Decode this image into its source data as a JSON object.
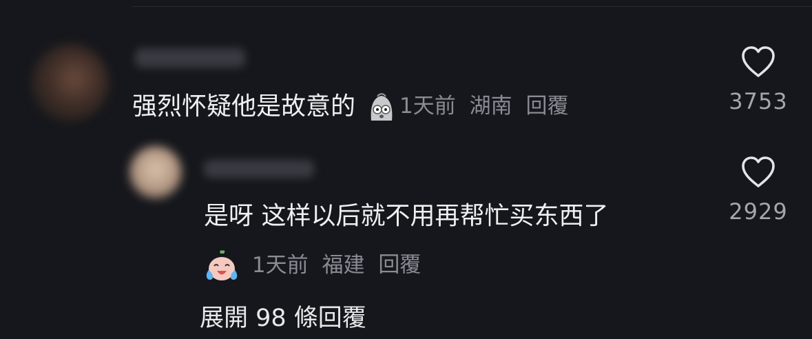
{
  "comments": [
    {
      "text": "强烈怀疑他是故意的",
      "emoji": "shocked-ghost-emoji",
      "time": "1天前",
      "location": "湖南",
      "reply_label": "回覆",
      "likes": "3753"
    },
    {
      "text": "是呀 这样以后就不用再帮忙买东西了",
      "emoji": "crying-laughing-emoji",
      "time": "1天前",
      "location": "福建",
      "reply_label": "回覆",
      "likes": "2929"
    }
  ],
  "expand_replies_label": "展開 98 條回覆",
  "icons": {
    "like": "heart-icon"
  },
  "colors": {
    "background": "#16171c",
    "text_primary": "#f0f0f2",
    "text_secondary": "#8a8b93",
    "like_count": "#a5a6ae"
  }
}
